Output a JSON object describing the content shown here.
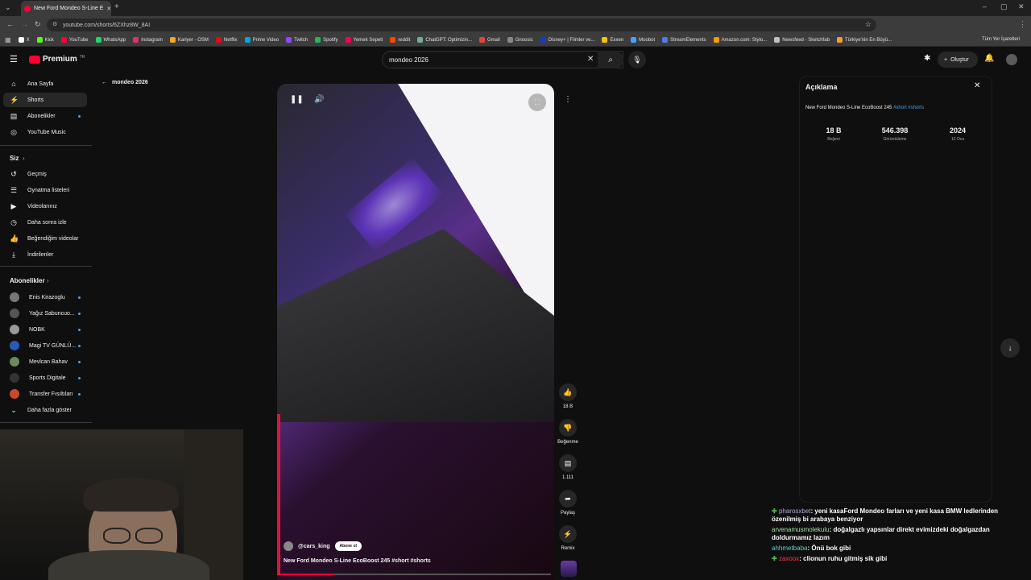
{
  "browser": {
    "tab_title": "New Ford Mondeo S-Line E",
    "url": "youtube.com/shorts/6ZXhz8W_8AI",
    "bookmarks": [
      "X",
      "Kick",
      "YouTube",
      "WhatsApp",
      "Instagram",
      "Kariyer - OSM",
      "Netflix",
      "Prime Video",
      "Twitch",
      "Spotify",
      "Yemek Sepeti",
      "reddit",
      "ChatGPT: Optimizin...",
      "Gmail",
      "Gnoosic",
      "Disney+ | Filmler ve...",
      "Exxen",
      "Moobot",
      "StreamElements",
      "Amazon.com: Stylo...",
      "Newsfeed - Sketchfab",
      "Türkiye'nin En Büyü..."
    ],
    "bookmarks_right": "Tüm Yer İşaretleri"
  },
  "header": {
    "logo": "Premium",
    "logo_region": "TR",
    "search_value": "mondeo 2026",
    "create_label": "Oluştur"
  },
  "sidebar": {
    "main": [
      {
        "label": "Ana Sayfa",
        "icon": "home-icon"
      },
      {
        "label": "Shorts",
        "icon": "shorts-icon"
      },
      {
        "label": "Abonelikler",
        "icon": "subscriptions-icon"
      },
      {
        "label": "YouTube Music",
        "icon": "music-icon"
      }
    ],
    "you_header": "Siz",
    "you": [
      "Geçmiş",
      "Oynatma listeleri",
      "Videolarınız",
      "Daha sonra izle",
      "Beğendiğim videolar",
      "İndirilenler"
    ],
    "subs_header": "Abonelikler",
    "subs": [
      "Enis Kirazoglu",
      "Yağız Sabuncuo...",
      "NOBK",
      "Magi TV GÜNLÜ...",
      "Mevlcan Bahav",
      "Sports Digitale",
      "Transfer Fısıltıları"
    ],
    "more": "Daha fazla göster"
  },
  "short": {
    "back_label": "mondeo 2026",
    "channel": "@cars_king",
    "subscribe": "Abone ol",
    "title": "New Ford Mondeo S-Line EcoBoost 245",
    "tags": "#short #shorts",
    "likes": "18 B",
    "dislike": "Beğenme",
    "comments": "1.111",
    "share": "Paylaş",
    "remix": "Remix"
  },
  "description": {
    "title": "Açıklama",
    "text": "New Ford Mondeo S-Line EcoBoost 245",
    "tags": "#short #shorts",
    "stats": [
      {
        "value": "18 B",
        "label": "Beğeni"
      },
      {
        "value": "546.398",
        "label": "Görüntüleme"
      },
      {
        "value": "2024",
        "label": "12 Oca"
      }
    ]
  },
  "chat": [
    {
      "user": "pharosxbet",
      "msg": ": yeni kasaFord Mondeo farları ve yeni kasa BMW ledlerinden özenilmiş bi arabaya benziyor",
      "color": "#b8a5d8"
    },
    {
      "user": "arvenamusmolekulu",
      "msg": ": doğalgazlı yapsınlar direkt evimizdeki doğalgazdan doldurmamız lazım",
      "color": "#9fe0a0"
    },
    {
      "user": "ahhmetbaba",
      "msg": ": Önü bok gibi",
      "color": "#5fd3c0"
    },
    {
      "user": "zaxoox",
      "msg": ": clionun ruhu gitmiş sik gibi",
      "color": "#ff3b3b"
    }
  ]
}
